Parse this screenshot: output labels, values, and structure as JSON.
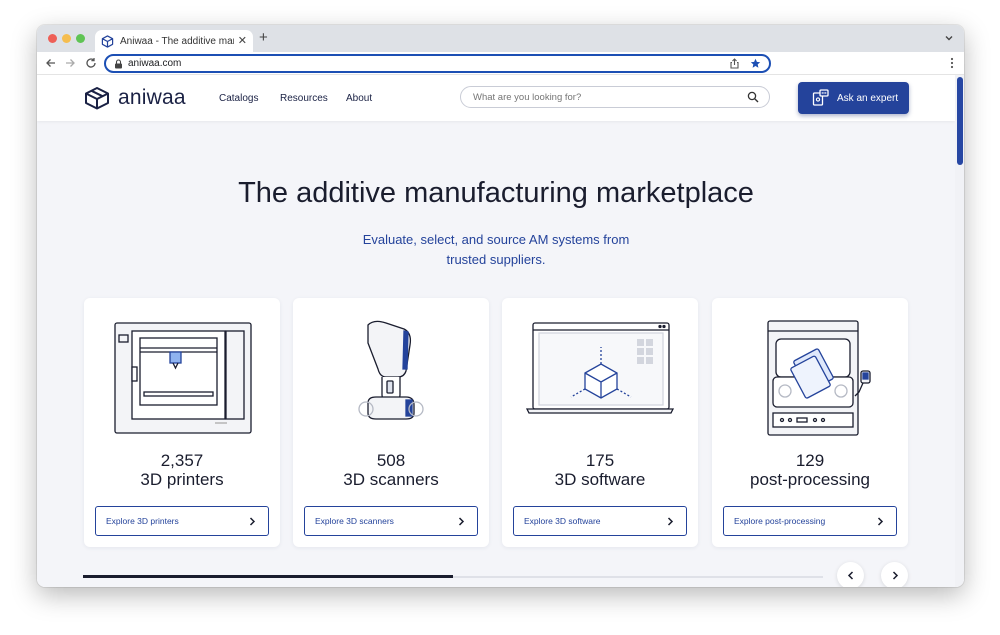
{
  "browser": {
    "tab_title": "Aniwaa - The additive manufac",
    "tab_close": "✕",
    "new_tab": "+",
    "url": "aniwaa.com"
  },
  "header": {
    "logo_text": "aniwaa",
    "nav": [
      "Catalogs",
      "Resources",
      "About"
    ],
    "search_placeholder": "What are you looking for?",
    "cta_label": "Ask an expert"
  },
  "hero": {
    "title": "The additive manufacturing marketplace",
    "subtitle": "Evaluate, select, and source AM systems from trusted suppliers."
  },
  "cards": [
    {
      "count": "2,357",
      "label": "3D printers",
      "button": "Explore 3D printers",
      "icon": "3d-printer-illustration"
    },
    {
      "count": "508",
      "label": "3D scanners",
      "button": "Explore 3D scanners",
      "icon": "3d-scanner-illustration"
    },
    {
      "count": "175",
      "label": "3D software",
      "button": "Explore 3D software",
      "icon": "3d-software-illustration"
    },
    {
      "count": "129",
      "label": "post-processing",
      "button": "Explore post-processing",
      "icon": "post-processing-illustration"
    }
  ],
  "carousel": {
    "progress": 0.5
  },
  "colors": {
    "brand": "#24439b",
    "text": "#1a1d2e",
    "page_bg": "#f4f5f9"
  }
}
